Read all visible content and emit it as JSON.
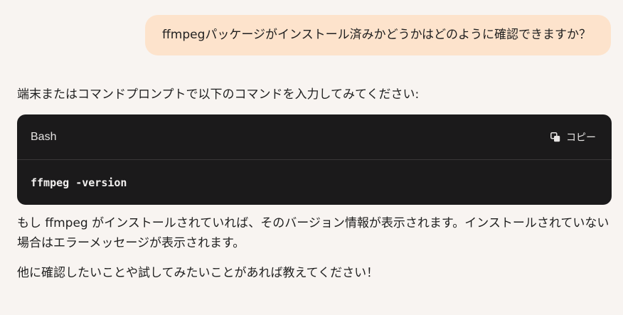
{
  "user_message": {
    "text": "ffmpegパッケージがインストール済みかどうかはどのように確認できますか？"
  },
  "assistant_message": {
    "intro": "端末またはコマンドプロンプトで以下のコマンドを入力してみてください:",
    "code_block": {
      "language": "Bash",
      "copy_label": "コピー",
      "copy_icon": "copy-icon",
      "code": "ffmpeg -version"
    },
    "result": "もし ffmpeg がインストールされていれば、そのバージョン情報が表示されます。インストールされていない場合はエラーメッセージが表示されます。",
    "closing": "他に確認したいことや試してみたいことがあれば教えてください！"
  },
  "colors": {
    "background": "#f8f4f1",
    "user_bubble": "#fde3cc",
    "code_background": "#1b1a1b",
    "code_text": "#f2f0ef"
  }
}
